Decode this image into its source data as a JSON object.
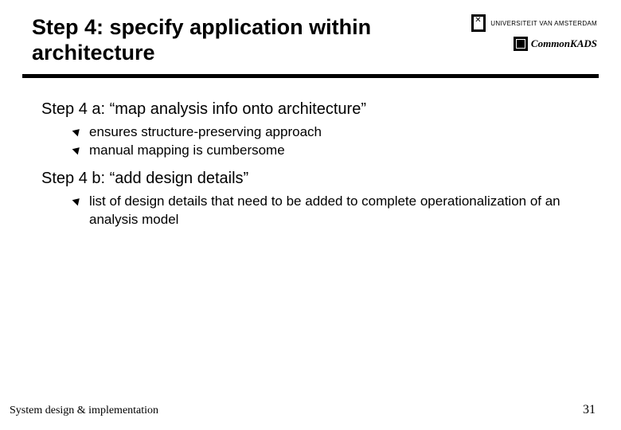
{
  "header": {
    "title": "Step 4: specify application within architecture",
    "logo_uva_text": "UNIVERSITEIT VAN AMSTERDAM",
    "logo_commonkads_text": "CommonKADS"
  },
  "content": {
    "step4a": "Step 4 a: “map analysis info onto architecture”",
    "step4a_bullets": [
      "ensures structure-preserving approach",
      "manual mapping is cumbersome"
    ],
    "step4b": "Step 4 b: “add design details”",
    "step4b_bullets": [
      "list of design details that need to be added to complete operationalization of an analysis model"
    ]
  },
  "footer": {
    "left": "System design & implementation",
    "page": "31"
  }
}
